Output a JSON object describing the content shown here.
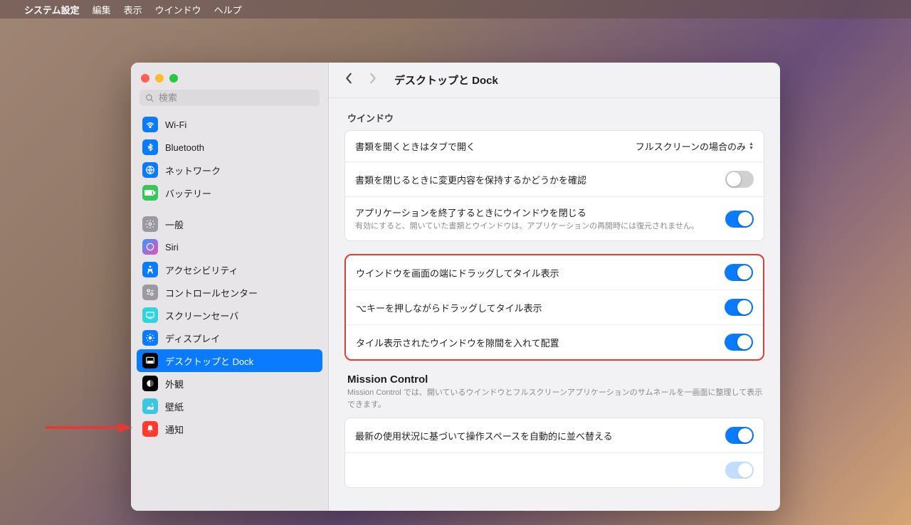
{
  "menubar": {
    "app_name": "システム設定",
    "items": [
      "編集",
      "表示",
      "ウインドウ",
      "ヘルプ"
    ]
  },
  "search": {
    "placeholder": "検索"
  },
  "sidebar": {
    "items": [
      {
        "label": "Wi-Fi",
        "icon": "wifi",
        "bg": "#0a7aff"
      },
      {
        "label": "Bluetooth",
        "icon": "bluetooth",
        "bg": "#0a7aff"
      },
      {
        "label": "ネットワーク",
        "icon": "network",
        "bg": "#0a7aff"
      },
      {
        "label": "バッテリー",
        "icon": "battery",
        "bg": "#34c759"
      },
      {
        "label": "一般",
        "icon": "gear",
        "bg": "#9a9aa0"
      },
      {
        "label": "Siri",
        "icon": "siri",
        "bg": "#222"
      },
      {
        "label": "アクセシビリティ",
        "icon": "accessibility",
        "bg": "#0a7aff"
      },
      {
        "label": "コントロールセンター",
        "icon": "control-center",
        "bg": "#9a9aa0"
      },
      {
        "label": "スクリーンセーバ",
        "icon": "screensaver",
        "bg": "#2fd4e0"
      },
      {
        "label": "ディスプレイ",
        "icon": "display",
        "bg": "#0a7aff"
      },
      {
        "label": "デスクトップと Dock",
        "icon": "desktop-dock",
        "bg": "#000",
        "selected": true
      },
      {
        "label": "外観",
        "icon": "appearance",
        "bg": "#000"
      },
      {
        "label": "壁紙",
        "icon": "wallpaper",
        "bg": "#3cc7e0"
      },
      {
        "label": "通知",
        "icon": "notifications",
        "bg": "#ff3b30"
      }
    ]
  },
  "content": {
    "title": "デスクトップと Dock",
    "window_section_label": "ウインドウ",
    "group1": {
      "row1": {
        "label": "書類を開くときはタブで開く",
        "value": "フルスクリーンの場合のみ"
      },
      "row2": {
        "label": "書類を閉じるときに変更内容を保持するかどうかを確認",
        "on": false
      },
      "row3": {
        "label": "アプリケーションを終了するときにウインドウを閉じる",
        "desc": "有効にすると、開いていた書類とウインドウは、アプリケーションの再開時には復元されません。",
        "on": true
      }
    },
    "group2": {
      "row1": {
        "label": "ウインドウを画面の端にドラッグしてタイル表示",
        "on": true
      },
      "row2": {
        "label": "⌥キーを押しながらドラッグしてタイル表示",
        "on": true
      },
      "row3": {
        "label": "タイル表示されたウインドウを隙間を入れて配置",
        "on": true
      }
    },
    "mission": {
      "heading": "Mission Control",
      "desc": "Mission Control では、開いているウインドウとフルスクリーンアプリケーションのサムネールを一画面に整理して表示できます。",
      "row1": {
        "label": "最新の使用状況に基づいて操作スペースを自動的に並べ替える",
        "on": true
      }
    }
  }
}
